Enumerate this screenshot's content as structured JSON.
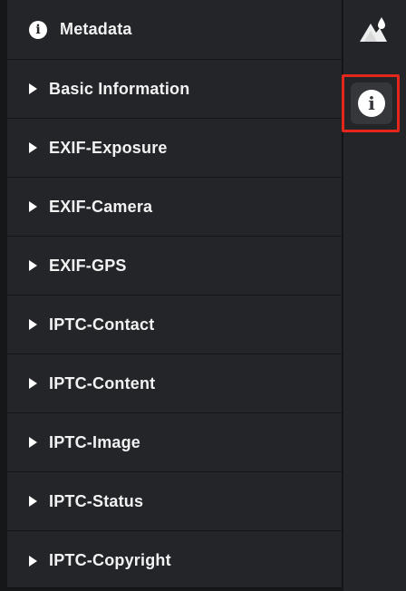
{
  "panel": {
    "header": {
      "title": "Metadata",
      "icon": "info-icon"
    },
    "sections": [
      {
        "label": "Basic Information"
      },
      {
        "label": "EXIF-Exposure"
      },
      {
        "label": "EXIF-Camera"
      },
      {
        "label": "EXIF-GPS"
      },
      {
        "label": "IPTC-Contact"
      },
      {
        "label": "IPTC-Content"
      },
      {
        "label": "IPTC-Image"
      },
      {
        "label": "IPTC-Status"
      },
      {
        "label": "IPTC-Copyright"
      }
    ]
  },
  "rail": {
    "items": [
      {
        "icon": "image-adjust-icon",
        "selected": false
      },
      {
        "icon": "info-icon",
        "selected": true,
        "glyph": "i"
      }
    ],
    "highlight_color": "#e4261b"
  },
  "colors": {
    "panel_bg": "#242529",
    "text": "#f2f2f2",
    "selected_bg": "#36373b"
  }
}
